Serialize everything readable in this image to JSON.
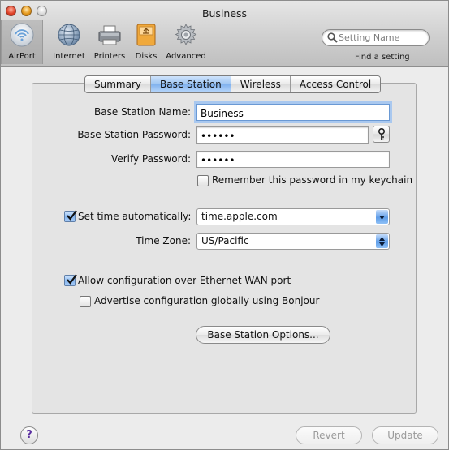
{
  "window": {
    "title": "Business"
  },
  "toolbar": {
    "items": [
      {
        "label": "AirPort",
        "icon": "airport-icon",
        "selected": true
      },
      {
        "label": "Internet",
        "icon": "globe-icon"
      },
      {
        "label": "Printers",
        "icon": "printer-icon"
      },
      {
        "label": "Disks",
        "icon": "disk-icon"
      },
      {
        "label": "Advanced",
        "icon": "gear-icon"
      }
    ],
    "search": {
      "placeholder": "Setting Name",
      "caption": "Find a setting"
    }
  },
  "tabs": [
    {
      "label": "Summary",
      "active": false
    },
    {
      "label": "Base Station",
      "active": true
    },
    {
      "label": "Wireless",
      "active": false
    },
    {
      "label": "Access Control",
      "active": false
    }
  ],
  "form": {
    "name_label": "Base Station Name:",
    "name_value": "Business",
    "password_label": "Base Station Password:",
    "password_value": "••••••",
    "verify_label": "Verify Password:",
    "verify_value": "••••••",
    "keychain_label": "Remember this password in my keychain",
    "keychain_checked": false,
    "time_auto_label": "Set time automatically:",
    "time_auto_checked": true,
    "time_server": "time.apple.com",
    "timezone_label": "Time Zone:",
    "timezone_value": "US/Pacific",
    "wan_label": "Allow configuration over Ethernet WAN port",
    "wan_checked": true,
    "bonjour_label": "Advertise configuration globally using Bonjour",
    "bonjour_checked": false,
    "options_button": "Base Station Options..."
  },
  "footer": {
    "help": "?",
    "revert": "Revert",
    "update": "Update"
  },
  "colors": {
    "accent": "#7fb0ee",
    "selection_ring": "#a9c8ef"
  }
}
